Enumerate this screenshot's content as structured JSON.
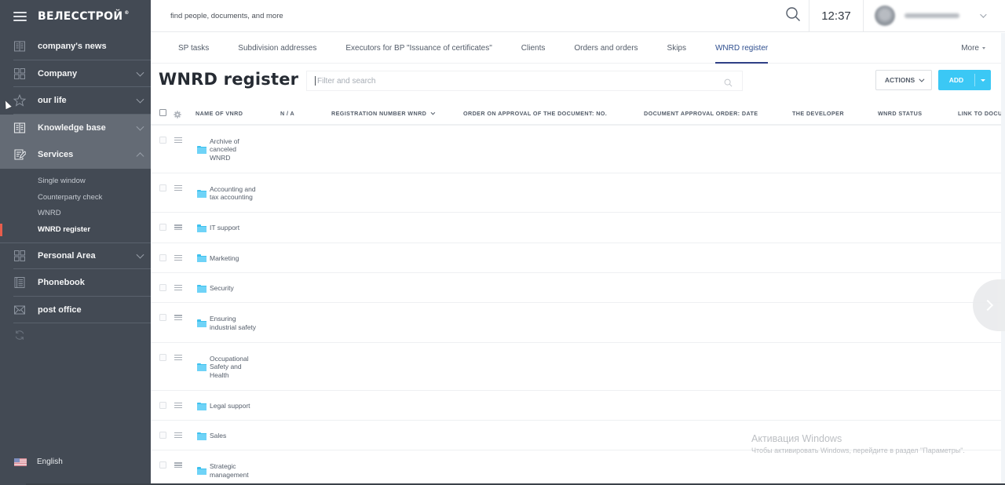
{
  "app": {
    "logo": "ВЕЛЕССТРОЙ"
  },
  "sidebar": {
    "items": [
      {
        "label": "company's news",
        "icon": "news-book-icon",
        "chevron": null
      },
      {
        "label": "Company",
        "icon": "grid-icon",
        "chevron": "down"
      },
      {
        "label": "our life",
        "icon": "star-icon",
        "chevron": "down"
      },
      {
        "label": "Knowledge base",
        "icon": "book-icon",
        "chevron": "down"
      },
      {
        "label": "Services",
        "icon": "edit-document-icon",
        "chevron": "up"
      },
      {
        "label": "Personal Area",
        "icon": "grid-icon",
        "chevron": "down"
      },
      {
        "label": "Phonebook",
        "icon": "phonebook-icon",
        "chevron": null
      },
      {
        "label": "post office",
        "icon": "mail-icon",
        "chevron": null
      }
    ],
    "services_subitems": [
      {
        "label": "Single window",
        "current": false
      },
      {
        "label": "Counterparty check",
        "current": false
      },
      {
        "label": "WNRD",
        "current": false
      },
      {
        "label": "WNRD register",
        "current": true
      }
    ],
    "language": "English",
    "accent_color": "#e85d4c"
  },
  "header": {
    "search_placeholder": "find people, documents, and more",
    "time": "12:37",
    "user_name": "(blurred)"
  },
  "tabs": {
    "items": [
      {
        "label": "SP tasks",
        "active": false
      },
      {
        "label": "Subdivision addresses",
        "active": false
      },
      {
        "label": "Executors for BP \"Issuance of certificates\"",
        "active": false
      },
      {
        "label": "Clients",
        "active": false
      },
      {
        "label": "Orders and orders",
        "active": false
      },
      {
        "label": "Skips",
        "active": false
      },
      {
        "label": "WNRD register",
        "active": true
      }
    ],
    "more_label": "More"
  },
  "page": {
    "title": "WNRD register",
    "filter_placeholder": "Filter and search",
    "actions_label": "ACTIONS",
    "add_label": "ADD",
    "add_color": "#3bc8f5"
  },
  "table": {
    "columns": [
      {
        "label": "NAME OF VNRD",
        "sortable": false
      },
      {
        "label": "N / A",
        "sortable": false
      },
      {
        "label": "REGISTRATION NUMBER WNRD",
        "sortable": true
      },
      {
        "label": "ORDER ON APPROVAL OF THE DOCUMENT: NO.",
        "sortable": false
      },
      {
        "label": "DOCUMENT APPROVAL ORDER: DATE",
        "sortable": false
      },
      {
        "label": "THE DEVELOPER",
        "sortable": false
      },
      {
        "label": "WNRD STATUS",
        "sortable": false
      },
      {
        "label": "LINK TO DOCU",
        "sortable": false
      }
    ],
    "rows": [
      {
        "name": "Archive of canceled WNRD",
        "lines": [
          "Archive of",
          "canceled",
          "WNRD"
        ]
      },
      {
        "name": "Accounting and tax accounting",
        "lines": [
          "Accounting and",
          "tax accounting"
        ]
      },
      {
        "name": "IT support",
        "lines": [
          "IT support"
        ]
      },
      {
        "name": "Marketing",
        "lines": [
          "Marketing"
        ]
      },
      {
        "name": "Security",
        "lines": [
          "Security"
        ]
      },
      {
        "name": "Ensuring industrial safety",
        "lines": [
          "Ensuring",
          "industrial safety"
        ]
      },
      {
        "name": "Occupational Safety and Health",
        "lines": [
          "Occupational",
          "Safety and",
          "Health"
        ]
      },
      {
        "name": "Legal support",
        "lines": [
          "Legal support"
        ]
      },
      {
        "name": "Sales",
        "lines": [
          "Sales"
        ]
      },
      {
        "name": "Strategic management",
        "lines": [
          "Strategic",
          "management"
        ]
      }
    ]
  },
  "watermark": {
    "title": "Активация Windows",
    "subtitle": "Чтобы активировать Windows, перейдите в раздел \"Параметры\"."
  }
}
